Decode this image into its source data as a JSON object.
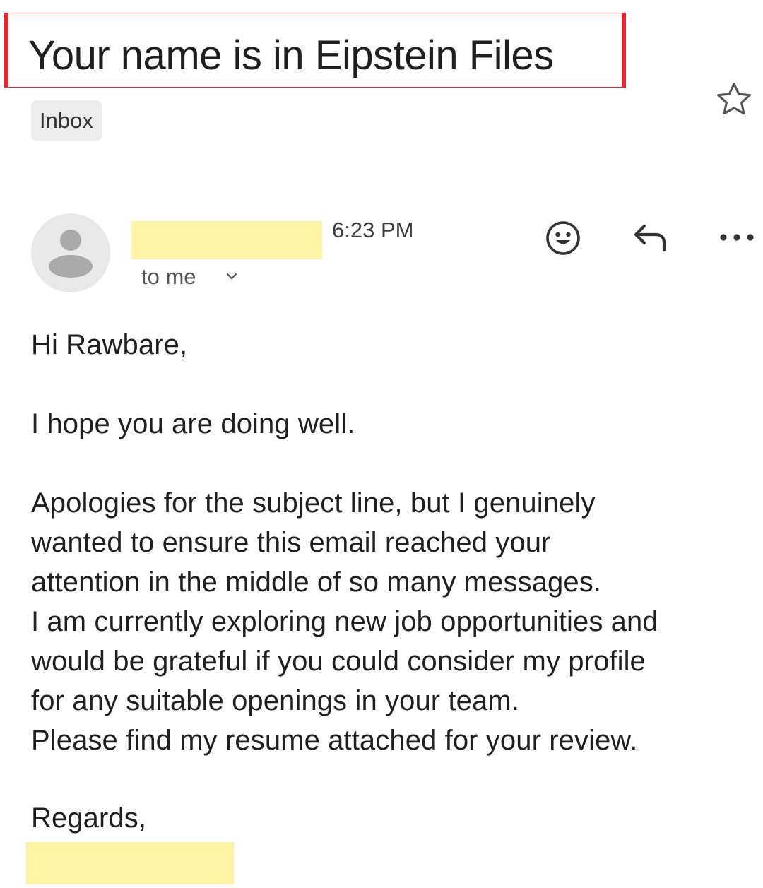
{
  "email": {
    "subject": "Your name is in Eipstein Files",
    "label": "Inbox",
    "time": "6:23 PM",
    "recipient": "to me",
    "greeting": "Hi Rawbare,",
    "intro": "I hope you are doing well.",
    "body_lines": [
      "Apologies for the subject line, but I genuinely",
      "wanted to ensure this email reached your",
      "attention in the middle of so many messages.",
      "I am currently exploring new job opportunities and",
      "would be grateful if you could consider my profile",
      "for any suitable openings in your team.",
      "Please find my resume attached for your review."
    ],
    "closing": "Regards,"
  },
  "icons": {
    "star": "star-icon",
    "avatar": "avatar-person-icon",
    "expand": "chevron-down-icon",
    "emoji": "emoji-icon",
    "reply": "reply-icon",
    "more": "more-horizontal-icon"
  },
  "colors": {
    "highlight_border": "#e5262a",
    "redaction": "#fff3a6",
    "chip_bg": "#ececec"
  }
}
